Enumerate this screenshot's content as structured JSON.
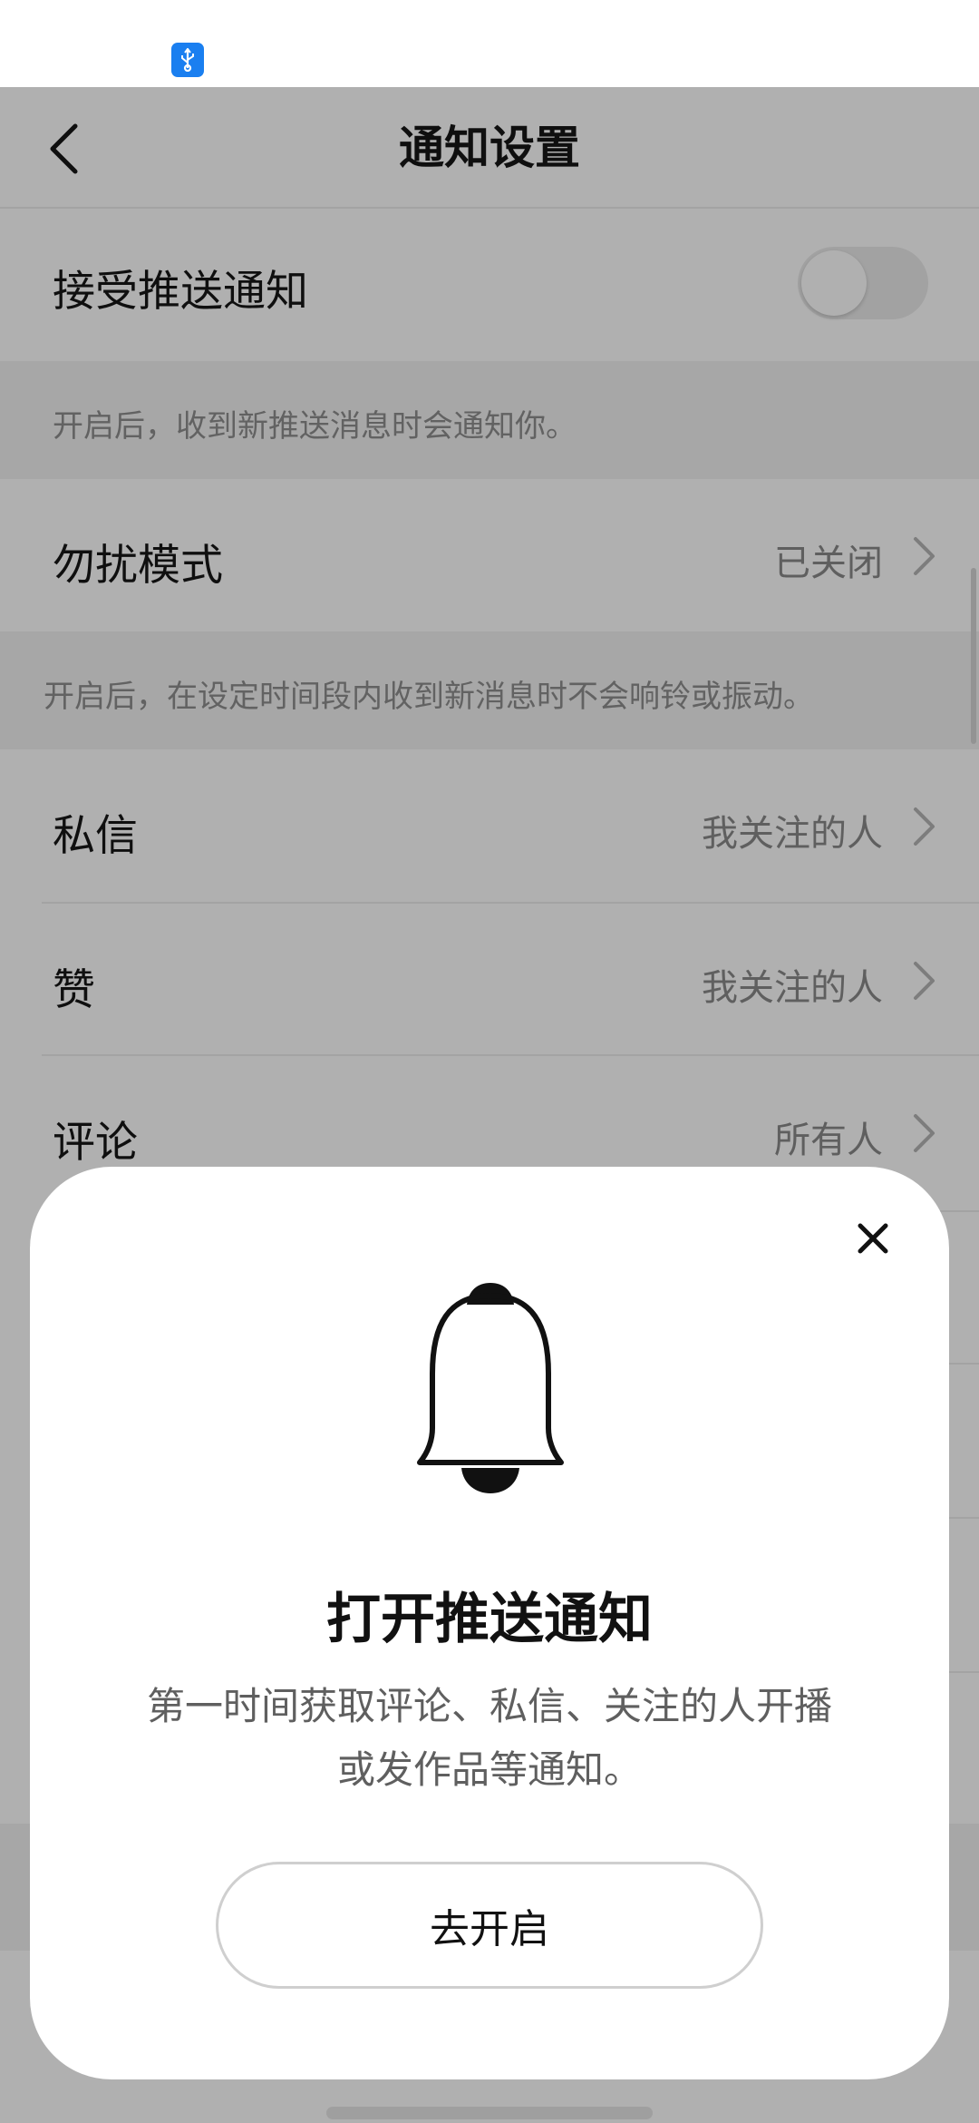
{
  "status_bar": {
    "usb_icon": "usb-icon"
  },
  "header": {
    "title": "通知设置",
    "back_icon": "chevron-left-icon"
  },
  "settings": {
    "push": {
      "label": "接受推送通知",
      "enabled": false,
      "description": "开启后，收到新推送消息时会通知你。"
    },
    "dnd": {
      "label": "勿扰模式",
      "value": "已关闭",
      "description": "开启后，在设定时间段内收到新消息时不会响铃或振动。"
    },
    "items": [
      {
        "label": "私信",
        "value": "我关注的人"
      },
      {
        "label": "赞",
        "value": "我关注的人"
      },
      {
        "label": "评论",
        "value": "所有人"
      }
    ],
    "chevron_icon": "chevron-right-icon"
  },
  "popup": {
    "icon": "bell-icon",
    "close_icon": "close-icon",
    "title": "打开推送通知",
    "description_line1": "第一时间获取评论、私信、关注的人开播",
    "description_line2": "或发作品等通知。",
    "button_label": "去开启"
  },
  "colors": {
    "overlay": "#000000",
    "usb_badge": "#1a7ff0",
    "secondary_text": "#8a8a8a"
  }
}
